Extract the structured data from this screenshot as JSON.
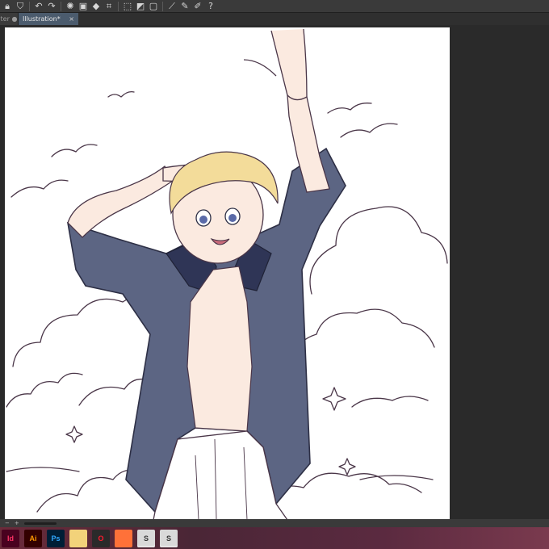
{
  "toolbar": {
    "icons": [
      "lock-icon",
      "brush-icon",
      "undo-icon",
      "redo-icon",
      "spinner-icon",
      "layers-icon",
      "fill-icon",
      "transform-icon",
      "selection-icon",
      "mask-icon",
      "square-icon",
      "ruler-icon",
      "pen-icon",
      "lasso-icon",
      "help-icon"
    ]
  },
  "tabs": {
    "prev_label": "ter",
    "active_label": "Illustration*",
    "close_glyph": "×"
  },
  "statusbar": {
    "zoom_minus": "−",
    "zoom_plus": "+"
  },
  "taskbar": {
    "apps": [
      {
        "name": "indesign",
        "label": "Id",
        "bg": "#49021f",
        "fg": "#ff3366"
      },
      {
        "name": "illustrator",
        "label": "Ai",
        "bg": "#330000",
        "fg": "#ff9a00"
      },
      {
        "name": "photoshop",
        "label": "Ps",
        "bg": "#001e36",
        "fg": "#31a8ff"
      },
      {
        "name": "notes",
        "label": "",
        "bg": "#f2d27a",
        "fg": "#5a4a1a"
      },
      {
        "name": "opera",
        "label": "O",
        "bg": "#2a2a2a",
        "fg": "#ff1b2d"
      },
      {
        "name": "firefox",
        "label": "",
        "bg": "#ff7139",
        "fg": "#ffd567"
      },
      {
        "name": "clip-studio",
        "label": "S",
        "bg": "#d9d9d9",
        "fg": "#333333"
      },
      {
        "name": "clip-studio-2",
        "label": "S",
        "bg": "#d9d9d9",
        "fg": "#333333"
      }
    ]
  }
}
